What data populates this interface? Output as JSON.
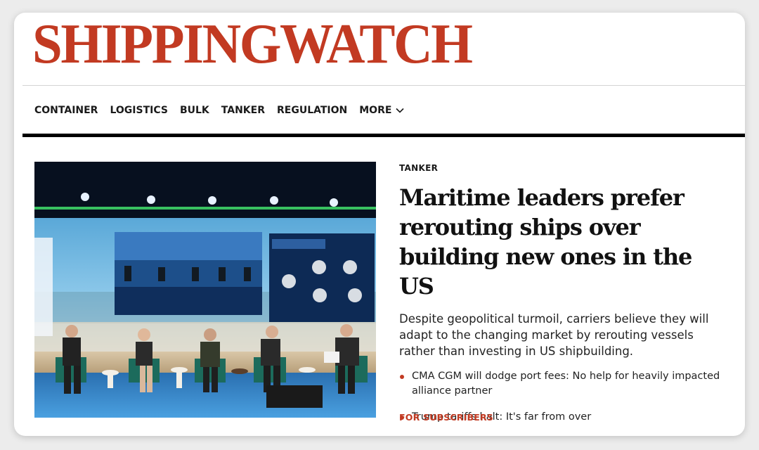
{
  "brand": {
    "logo_text": "SHIPPINGWATCH",
    "brand_color": "#c23a22"
  },
  "nav": {
    "items": [
      {
        "label": "CONTAINER"
      },
      {
        "label": "LOGISTICS"
      },
      {
        "label": "BULK"
      },
      {
        "label": "TANKER"
      },
      {
        "label": "REGULATION"
      }
    ],
    "more_label": "MORE",
    "more_icon": "chevron-down-icon"
  },
  "feature": {
    "image_description_icon": "conference-panel-photo",
    "category": "TANKER",
    "headline": "Maritime leaders prefer rerouting ships over building new ones in the US",
    "summary": "Despite geopolitical turmoil, carriers believe they will adapt to the changing market by rerouting vessels rather than investing in US shipbuilding.",
    "related": [
      {
        "title": "CMA CGM will dodge port fees: No help for heavily impacted alliance partner"
      },
      {
        "title": "Trump tariffs halt: It's far from over"
      }
    ],
    "subscribers_label": "FOR SUBSCRIBERS"
  }
}
